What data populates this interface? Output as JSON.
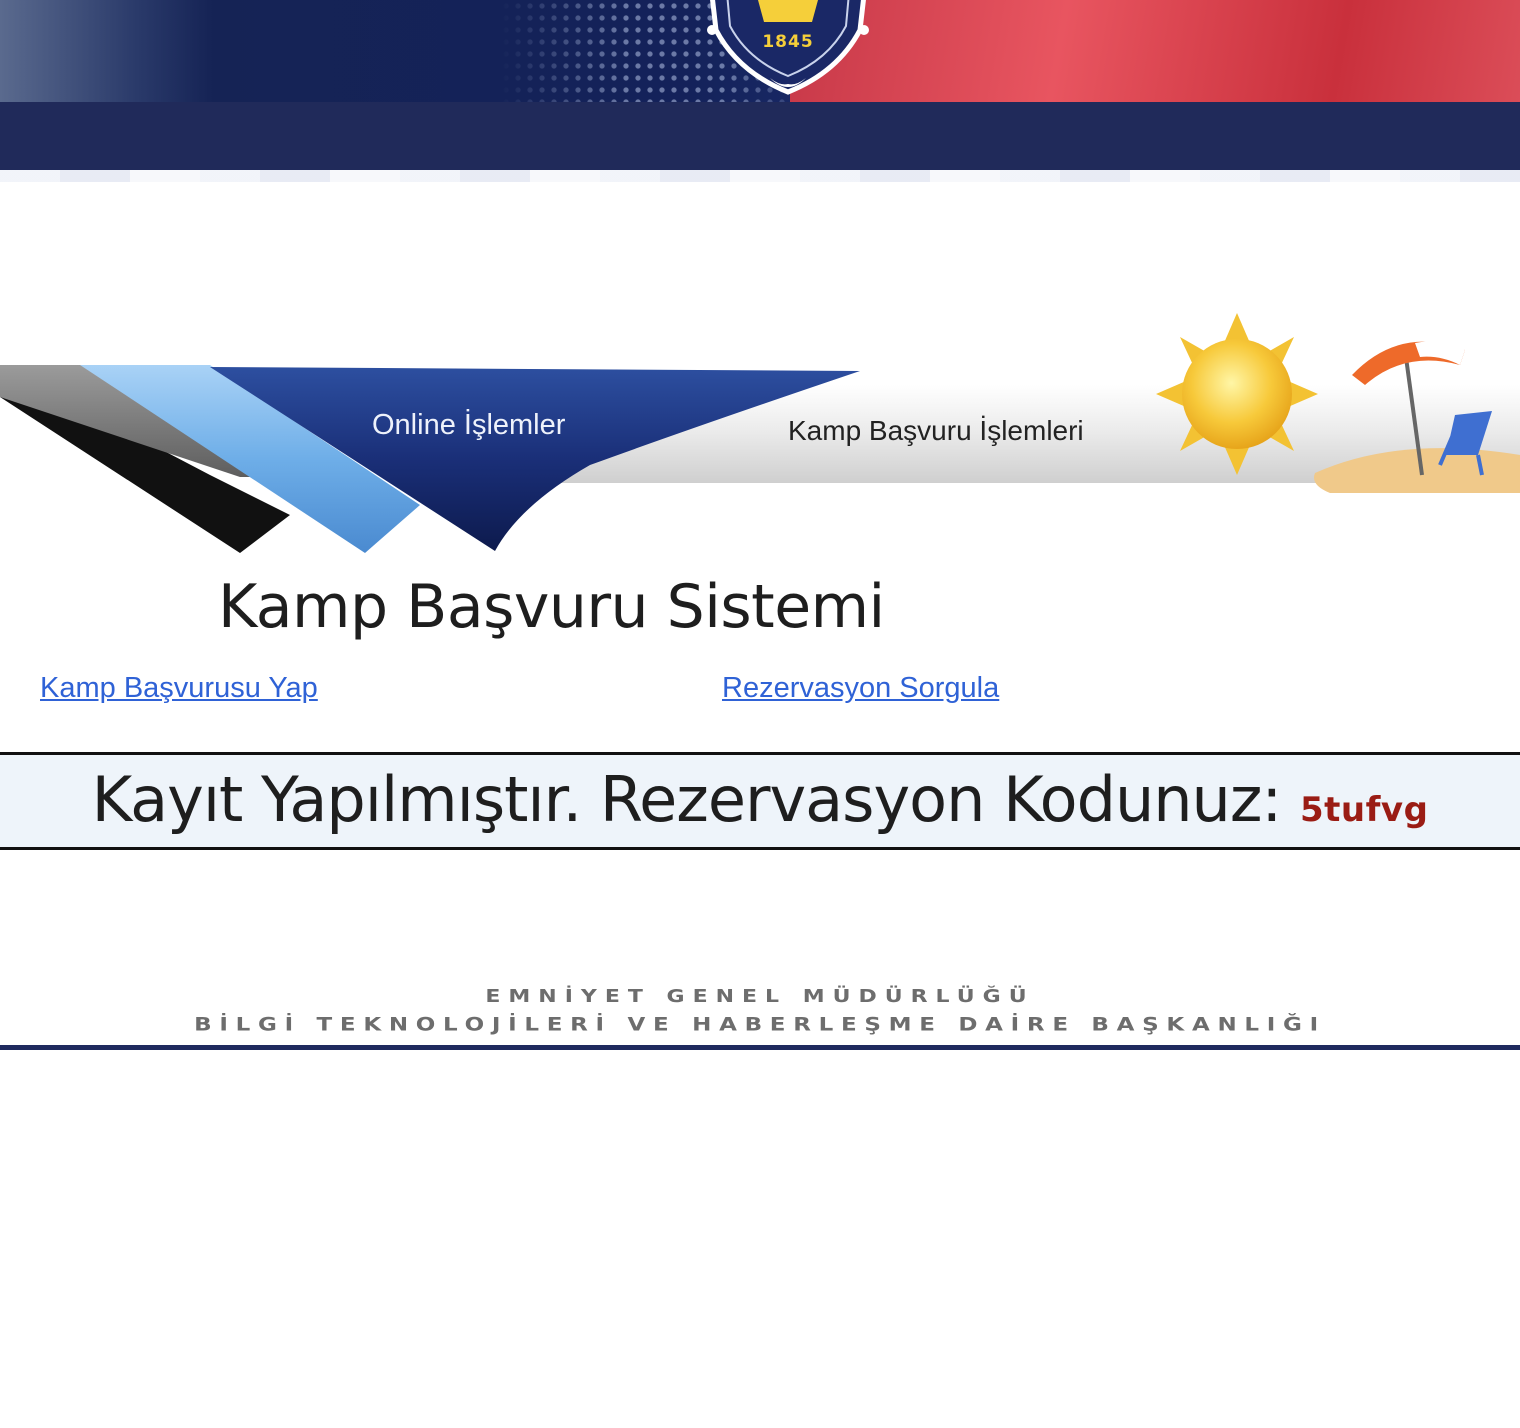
{
  "header": {
    "emblem_year": "1845",
    "colors": {
      "navy": "#202a5a",
      "flag_red": "#e05560"
    }
  },
  "banner": {
    "online_label": "Online İşlemler",
    "section_label": "Kamp Başvuru İşlemleri",
    "icons": [
      "sun-icon",
      "beach-umbrella-icon",
      "beach-chair-icon"
    ]
  },
  "page": {
    "title": "Kamp Başvuru Sistemi"
  },
  "links": {
    "apply": "Kamp Başvurusu Yap",
    "query": "Rezervasyon Sorgula"
  },
  "result": {
    "message": "Kayıt Yapılmıştır. Rezervasyon Kodunuz:",
    "code": "5tufvg"
  },
  "footer": {
    "line1": "EMNİYET GENEL MÜDÜRLÜĞÜ",
    "line2": "BİLGİ TEKNOLOJİLERİ VE HABERLEŞME DAİRE BAŞKANLIĞI"
  }
}
